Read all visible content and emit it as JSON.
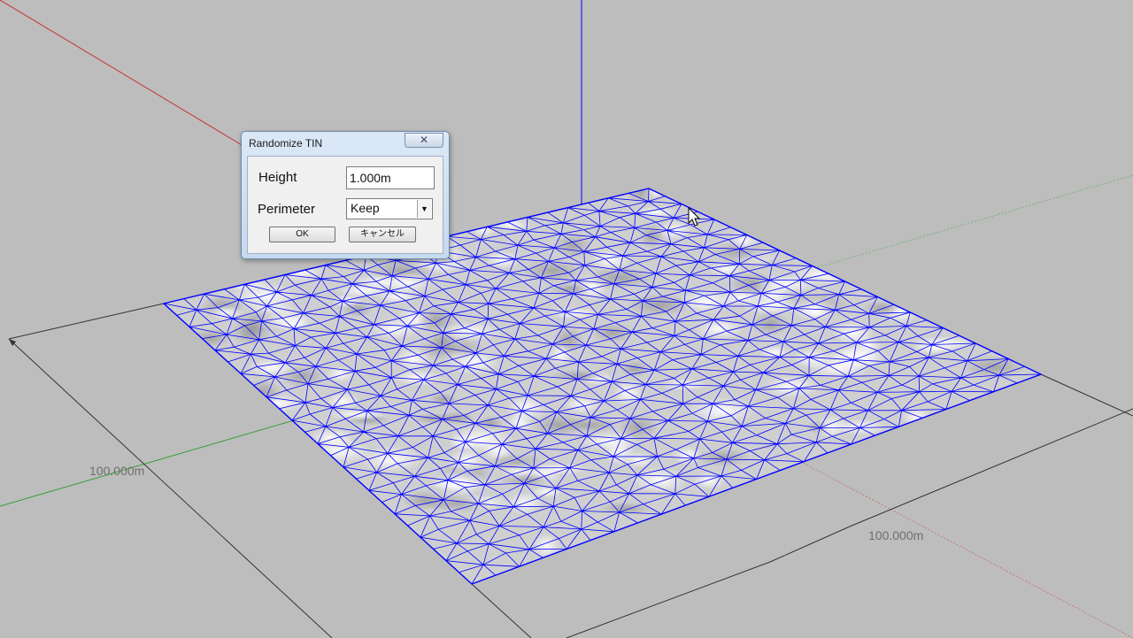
{
  "dialog": {
    "title": "Randomize TIN",
    "close_label": "✕",
    "height_label": "Height",
    "height_value": "1.000m",
    "perimeter_label": "Perimeter",
    "perimeter_value": "Keep",
    "ok_label": "OK",
    "cancel_label": "キャンセル"
  },
  "viewport": {
    "dimension_left": "100.000m",
    "dimension_right": "100.000m",
    "colors": {
      "background": "#bdbdbd",
      "mesh": "#0000ff",
      "axis_red": "#c83232",
      "axis_green": "#32a032",
      "axis_blue": "#0000ff"
    }
  }
}
